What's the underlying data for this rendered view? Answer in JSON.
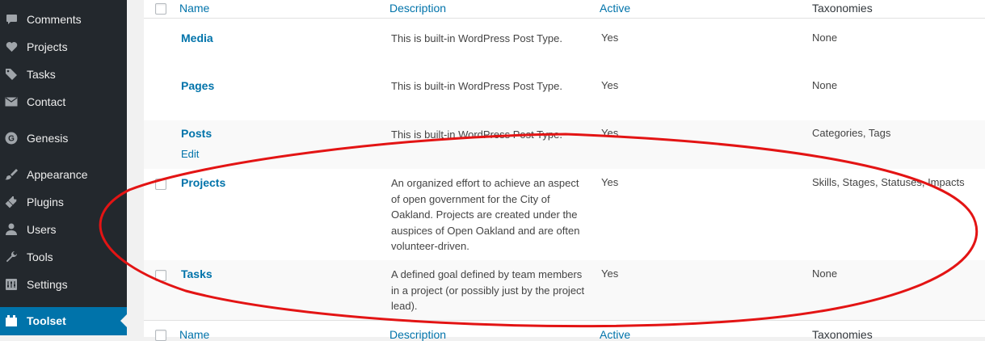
{
  "sidebar": {
    "items": [
      {
        "label": "Comments",
        "icon": "comment-icon"
      },
      {
        "label": "Projects",
        "icon": "heart-icon"
      },
      {
        "label": "Tasks",
        "icon": "tag-icon"
      },
      {
        "label": "Contact",
        "icon": "mail-icon"
      },
      {
        "label": "Genesis",
        "icon": "genesis-icon"
      },
      {
        "label": "Appearance",
        "icon": "paintbrush-icon"
      },
      {
        "label": "Plugins",
        "icon": "plug-icon"
      },
      {
        "label": "Users",
        "icon": "user-icon"
      },
      {
        "label": "Tools",
        "icon": "wrench-icon"
      },
      {
        "label": "Settings",
        "icon": "settings-icon"
      },
      {
        "label": "Toolset",
        "icon": "toolset-icon"
      }
    ],
    "active": "Toolset"
  },
  "table": {
    "headers": {
      "name": "Name",
      "description": "Description",
      "active": "Active",
      "taxonomies": "Taxonomies"
    },
    "rows": [
      {
        "name": "Media",
        "description": "This is built-in WordPress Post Type.",
        "active": "Yes",
        "taxonomies": "None"
      },
      {
        "name": "Pages",
        "description": "This is built-in WordPress Post Type.",
        "active": "Yes",
        "taxonomies": "None"
      },
      {
        "name": "Posts",
        "edit": "Edit",
        "description": "This is built-in WordPress Post Type.",
        "active": "Yes",
        "taxonomies": "Categories, Tags"
      },
      {
        "name": "Projects",
        "description": "An organized effort to achieve an aspect of open government for the City of Oakland. Projects are created under the auspices of Open Oakland and are often volunteer-driven.",
        "active": "Yes",
        "taxonomies": "Skills, Stages, Statuses, Impacts"
      },
      {
        "name": "Tasks",
        "description": "A defined goal defined by team members in a project (or possibly just by the project lead).",
        "active": "Yes",
        "taxonomies": "None"
      }
    ]
  },
  "colors": {
    "sidebar_bg": "#23282d",
    "active_bg": "#0073aa",
    "link": "#0073aa",
    "annotation": "#e31414"
  }
}
